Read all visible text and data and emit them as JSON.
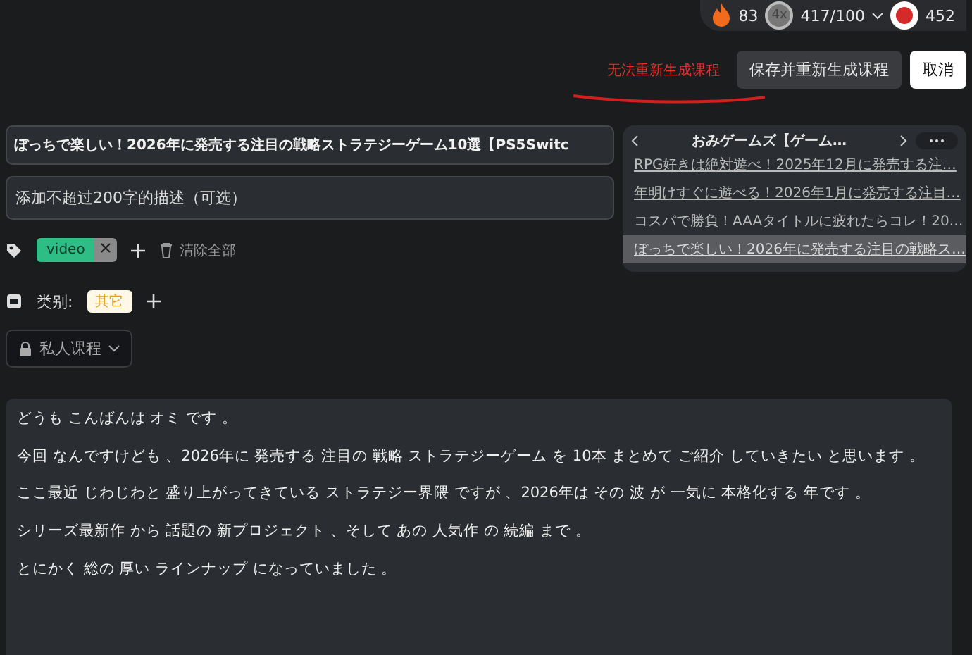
{
  "stats": {
    "streak": "83",
    "multiplier": "4x",
    "progress": "417/100",
    "points": "452"
  },
  "actions": {
    "error": "无法重新生成课程",
    "buttons": [
      {
        "label": "保存并重新生成课程",
        "kind": "secondary"
      },
      {
        "label": "取消",
        "kind": "primary"
      }
    ]
  },
  "form": {
    "title_value": "ぼっちで楽しい！2026年に発売する注目の戦略ストラテジーゲーム10選【PS5Switc",
    "description_placeholder": "添加不超过200字的描述（可选）",
    "tags": [
      {
        "label": "video"
      }
    ],
    "clear_all": "清除全部",
    "category_label": "类别:",
    "category_badge": "其它",
    "visibility": "私人课程"
  },
  "playlist": {
    "title": "おみゲームズ【ゲーム…",
    "items": [
      {
        "label": "RPG好きは絶対遊べ！2025年12月に発売する注…",
        "underlined": true,
        "selected": false
      },
      {
        "label": "年明けすぐに遊べる！2026年1月に発売する注目…",
        "underlined": true,
        "selected": false
      },
      {
        "label": "コスパで勝負！AAAタイトルに疲れたらコレ！20…",
        "underlined": false,
        "selected": false
      },
      {
        "label": "ぼっちで楽しい！2026年に発売する注目の戦略ス…",
        "underlined": true,
        "selected": true
      }
    ]
  },
  "transcript": [
    "どうも こんばんは オミ です 。",
    "今回 なんですけども 、2026年に 発売する 注目の 戦略 ストラテジーゲーム を 10本 まとめて ご紹介 していきたい と思います 。",
    "ここ最近 じわじわと 盛り上がってきている ストラテジー界隈 ですが 、2026年は その 波 が 一気に 本格化する 年です 。",
    "シリーズ最新作 から 話題の 新プロジェクト 、そして あの 人気作 の 続編 まで 。",
    "とにかく 総の 厚い ラインナップ になっていました 。"
  ]
}
